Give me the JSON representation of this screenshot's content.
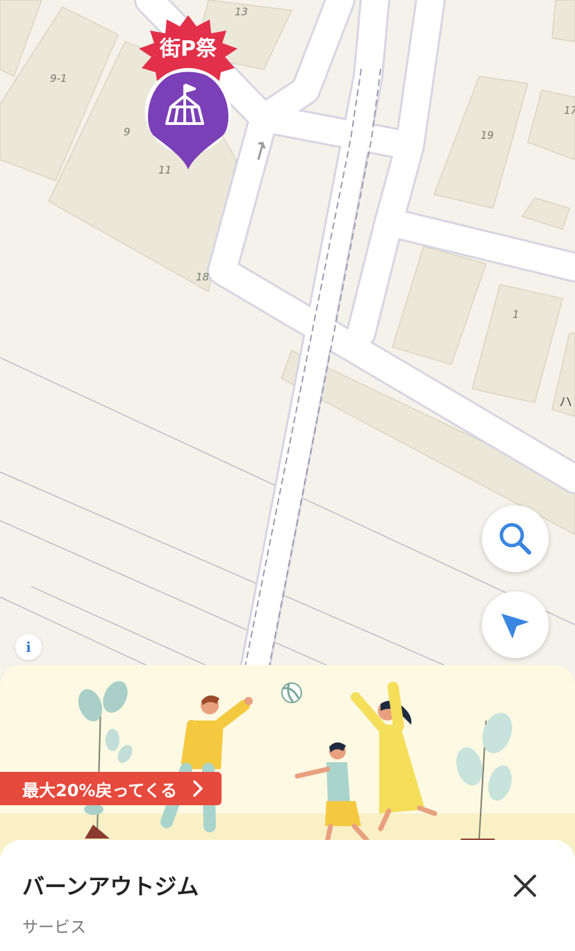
{
  "map": {
    "block_labels": [
      "13",
      "9-1",
      "9",
      "11",
      "18",
      "19",
      "17",
      "1",
      "ハ"
    ],
    "colors": {
      "background": "#f4f2ea",
      "building": "#ebe8d9",
      "road": "#ffffff",
      "road_edge": "#d6d5e3"
    }
  },
  "pin": {
    "badge_text": "街P祭",
    "badge_color": "#e2304a",
    "marker_color": "#7b3fb8",
    "icon": "tent-icon"
  },
  "controls": {
    "search_icon": "search-icon",
    "location_icon": "navigation-arrow-icon",
    "info_label": "i"
  },
  "banner": {
    "promo_text": "最大20%戻ってくる",
    "promo_color": "#e64a3c",
    "illustration": "family-playing-ball"
  },
  "sheet": {
    "place_name": "バーンアウトジム",
    "category": "サービス",
    "close_icon": "close-icon"
  }
}
